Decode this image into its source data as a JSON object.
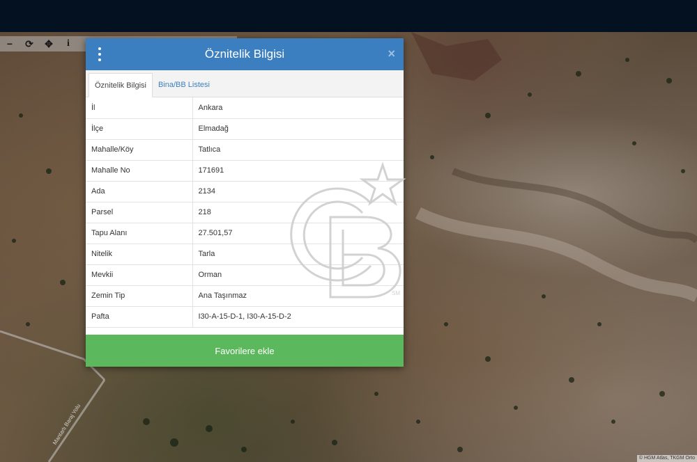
{
  "toolbar": {
    "icons": [
      "zoom-out-icon",
      "refresh-icon",
      "locate-icon",
      "info-icon"
    ],
    "zoom_out": "−",
    "refresh": "⟳",
    "locate": "✥",
    "info": "i"
  },
  "map": {
    "road_label": "Mantarlı Baraj Yolu",
    "attribution": "© HGM Atlas, TKGM Orto"
  },
  "dialog": {
    "title": "Öznitelik Bilgisi",
    "close": "×",
    "tabs": [
      {
        "label": "Öznitelik Bilgisi",
        "active": true
      },
      {
        "label": "Bina/BB Listesi",
        "active": false
      }
    ],
    "rows": [
      {
        "key": "İl",
        "value": "Ankara"
      },
      {
        "key": "İlçe",
        "value": "Elmadağ"
      },
      {
        "key": "Mahalle/Köy",
        "value": "Tatlıca"
      },
      {
        "key": "Mahalle No",
        "value": "171691"
      },
      {
        "key": "Ada",
        "value": "2134"
      },
      {
        "key": "Parsel",
        "value": "218"
      },
      {
        "key": "Tapu Alanı",
        "value": "27.501,57"
      },
      {
        "key": "Nitelik",
        "value": "Tarla"
      },
      {
        "key": "Mevkii",
        "value": "Orman"
      },
      {
        "key": "Zemin Tip",
        "value": "Ana Taşınmaz"
      },
      {
        "key": "Pafta",
        "value": "I30-A-15-D-1, I30-A-15-D-2"
      }
    ],
    "favorite_button": "Favorilere ekle"
  },
  "watermark": {
    "text": "CB",
    "mark": "SM"
  },
  "colors": {
    "header_blue": "#3c7fc0",
    "favorite_green": "#5cb85c",
    "topbar": "#031120"
  }
}
